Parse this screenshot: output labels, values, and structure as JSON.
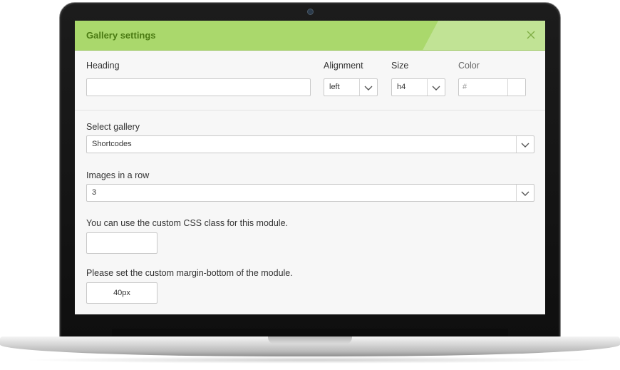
{
  "modal": {
    "title": "Gallery settings",
    "close_icon": "close-icon"
  },
  "heading": {
    "label": "Heading",
    "value": ""
  },
  "alignment": {
    "label": "Alignment",
    "selected": "left"
  },
  "size": {
    "label": "Size",
    "selected": "h4"
  },
  "color": {
    "label": "Color",
    "placeholder": "#"
  },
  "gallery": {
    "label": "Select gallery",
    "selected": "Shortcodes"
  },
  "images_in_row": {
    "label": "Images in a row",
    "selected": "3"
  },
  "css_class": {
    "label": "You can use the custom CSS class for this module.",
    "value": ""
  },
  "margin_bottom": {
    "label": "Please set the custom margin-bottom of the module.",
    "value": "40px"
  },
  "colors": {
    "header_bg": "#aad86c",
    "title_text": "#4a7a12",
    "panel_bg": "#f7f7f7"
  }
}
